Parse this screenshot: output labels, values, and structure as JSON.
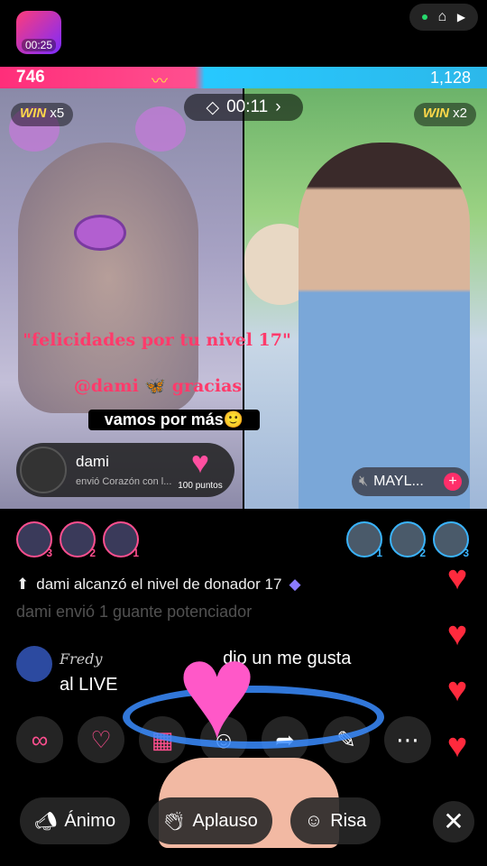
{
  "top": {
    "badge_timer": "00:25"
  },
  "battle": {
    "left_score": "746",
    "right_score": "1,128",
    "timer": "00:11",
    "left_win": "x5",
    "right_win": "x2",
    "win_label": "WIN"
  },
  "captions": {
    "line1": "\"felicidades por tu nivel 17\"",
    "line2": "@dami 🦋 gracias",
    "line3": "vamos por más🙂"
  },
  "gift_notice": {
    "name": "dami",
    "sub": "envió Corazón con l...",
    "points": "100 puntos"
  },
  "opponent": {
    "name": "MAYL..."
  },
  "viewers_left": [
    "3",
    "2",
    "1"
  ],
  "viewers_right": [
    "1",
    "2",
    "3"
  ],
  "chat": {
    "system": "dami alcanzó el nivel de donador 17",
    "faded": "dami envió 1 guante potenciador",
    "msg_user": "Fredy",
    "msg_text": "dio un me gusta",
    "msg_text2": "al LIVE"
  },
  "reactions": [
    "Ánimo",
    "Aplauso",
    "Risa"
  ],
  "icons": {
    "actions": [
      "link-icon",
      "co-host-icon",
      "gift-box-icon",
      "sticker-icon",
      "share-icon",
      "edit-icon",
      "more-icon"
    ]
  },
  "colors": {
    "left_team": "#ff2e7a",
    "right_team": "#27c8ff",
    "heart": "#ff2a3d"
  }
}
